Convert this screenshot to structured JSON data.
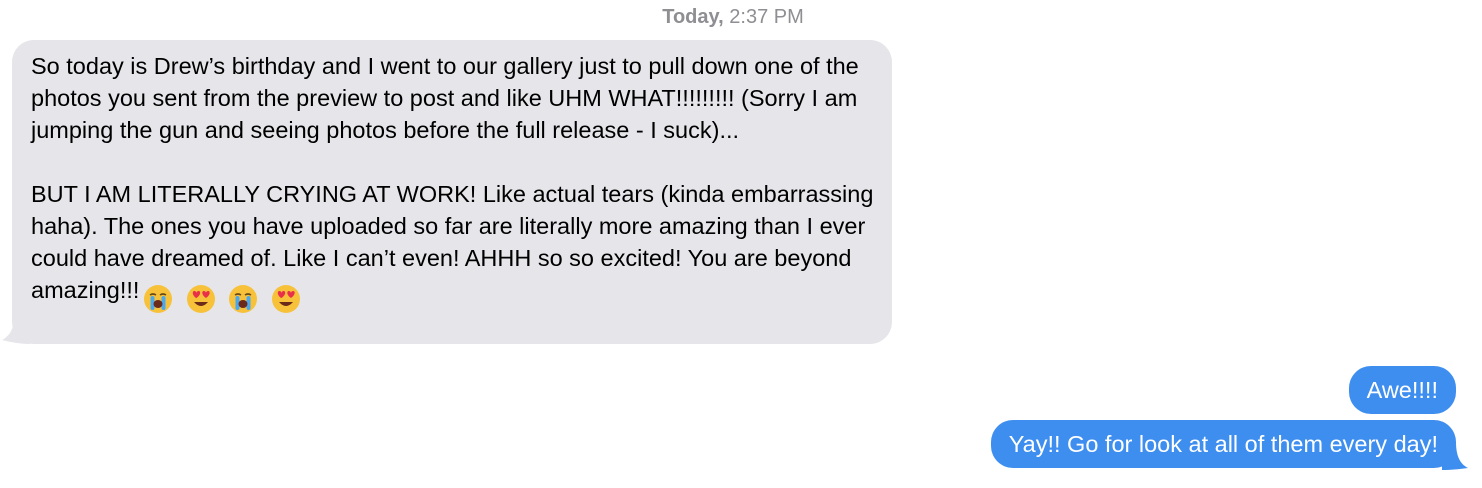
{
  "conversation": {
    "timestamp_day": "Today,",
    "timestamp_time": "2:37 PM",
    "incoming": {
      "paragraph1": "So today is Drew’s birthday and I went to our gallery just to pull down one of the photos you sent from the preview to post and like UHM WHAT!!!!!!!!! (Sorry I am jumping the gun and seeing photos before the full release - I suck)...",
      "paragraph2": "BUT I AM LITERALLY CRYING AT WORK! Like actual tears (kinda embarrassing haha). The ones you have uploaded so far are literally more amazing than I ever could have dreamed of. Like I can’t even! AHHH so so excited! You are beyond amazing!!!",
      "emojis": [
        "loudly-crying-face-icon",
        "heart-eyes-face-icon",
        "loudly-crying-face-icon",
        "heart-eyes-face-icon"
      ]
    },
    "outgoing": [
      {
        "text": "Awe!!!!"
      },
      {
        "text": "Yay!! Go for look at all of them every day!"
      }
    ],
    "colors": {
      "incoming_bubble": "#e5e5ea",
      "outgoing_bubble": "#3e8ef0",
      "timestamp": "#8e8e93"
    }
  }
}
